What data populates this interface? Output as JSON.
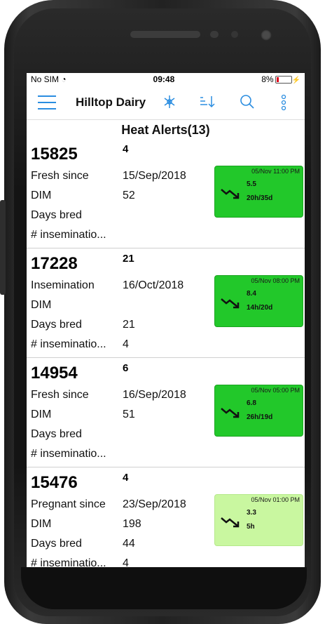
{
  "status_bar": {
    "carrier": "No SIM",
    "time": "09:48",
    "battery": "8%"
  },
  "toolbar": {
    "title": "Hilltop Dairy"
  },
  "section": {
    "title": "Heat Alerts(13)"
  },
  "cards": [
    {
      "id": "15825",
      "sub": "4",
      "rows": [
        {
          "label": "Fresh since",
          "value": "15/Sep/2018"
        },
        {
          "label": "DIM",
          "value": "52"
        },
        {
          "label": "Days bred",
          "value": ""
        },
        {
          "label": "# inseminatio...",
          "value": ""
        }
      ],
      "alert": {
        "time": "05/Nov 11:00 PM",
        "value": "5.5",
        "range": "20h/35d",
        "style": "dark"
      }
    },
    {
      "id": "17228",
      "sub": "21",
      "rows": [
        {
          "label": "Insemination",
          "value": "16/Oct/2018"
        },
        {
          "label": "DIM",
          "value": ""
        },
        {
          "label": "Days bred",
          "value": "21"
        },
        {
          "label": "# inseminatio...",
          "value": "4"
        }
      ],
      "alert": {
        "time": "05/Nov 08:00 PM",
        "value": "8.4",
        "range": "14h/20d",
        "style": "dark"
      }
    },
    {
      "id": "14954",
      "sub": "6",
      "rows": [
        {
          "label": "Fresh since",
          "value": "16/Sep/2018"
        },
        {
          "label": "DIM",
          "value": "51"
        },
        {
          "label": "Days bred",
          "value": ""
        },
        {
          "label": "# inseminatio...",
          "value": ""
        }
      ],
      "alert": {
        "time": "05/Nov 05:00 PM",
        "value": "6.8",
        "range": "26h/19d",
        "style": "dark"
      }
    },
    {
      "id": "15476",
      "sub": "4",
      "rows": [
        {
          "label": "Pregnant since",
          "value": "23/Sep/2018"
        },
        {
          "label": "DIM",
          "value": "198"
        },
        {
          "label": "Days bred",
          "value": "44"
        },
        {
          "label": "# inseminatio...",
          "value": "4"
        }
      ],
      "alert": {
        "time": "05/Nov 01:00 PM",
        "value": "3.3",
        "range": "5h",
        "style": "light"
      }
    }
  ],
  "colors": {
    "accent": "#2a8de0",
    "alert_dark": "#22c82a",
    "alert_light": "#c9f7a0"
  }
}
